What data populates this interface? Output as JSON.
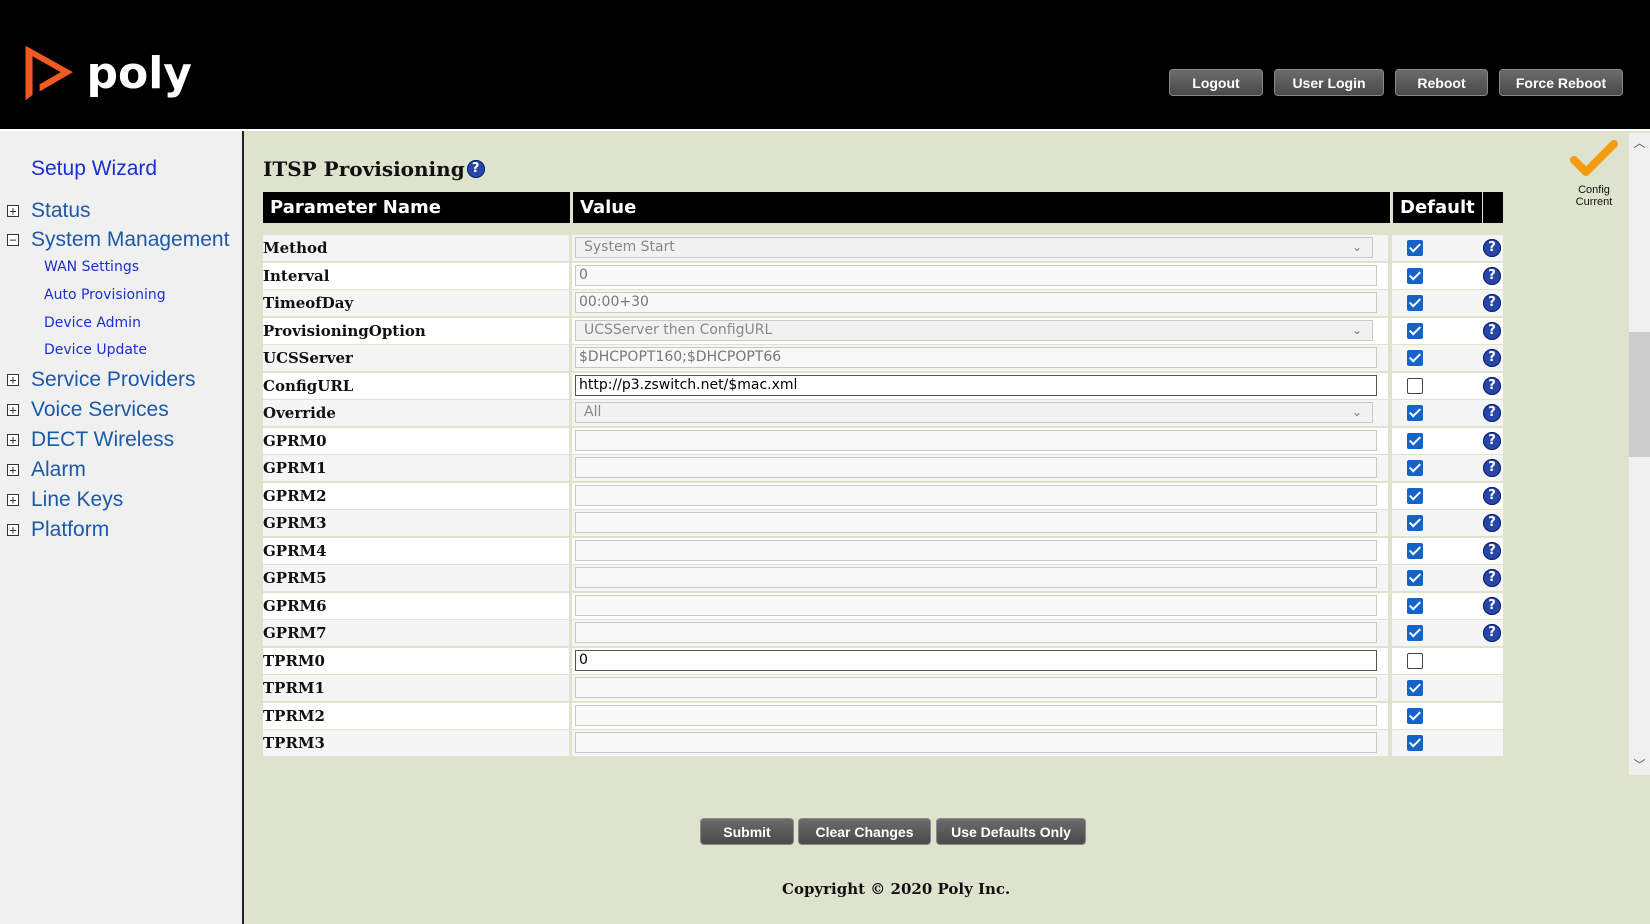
{
  "brand": {
    "logo_text": "poly",
    "accent": "#f15a22"
  },
  "header_buttons": [
    {
      "label": "Logout"
    },
    {
      "label": "User Login"
    },
    {
      "label": "Reboot"
    },
    {
      "label": "Force Reboot"
    }
  ],
  "sidebar": {
    "top": "Setup Wizard",
    "items": [
      {
        "label": "Status",
        "toggle": "+"
      },
      {
        "label": "System Management",
        "toggle": "−"
      },
      {
        "label": "Service Providers",
        "toggle": "+"
      },
      {
        "label": "Voice Services",
        "toggle": "+"
      },
      {
        "label": "DECT Wireless",
        "toggle": "+"
      },
      {
        "label": "Alarm",
        "toggle": "+"
      },
      {
        "label": "Line Keys",
        "toggle": "+"
      },
      {
        "label": "Platform",
        "toggle": "+"
      }
    ],
    "sub_items": [
      "WAN Settings",
      "Auto Provisioning",
      "Device Admin",
      "Device Update"
    ]
  },
  "page": {
    "title": "ITSP Provisioning",
    "help_glyph": "?",
    "config_status": {
      "line1": "Config",
      "line2": "Current"
    }
  },
  "table": {
    "headers": {
      "param": "Parameter Name",
      "value": "Value",
      "default": "Default"
    },
    "rows": [
      {
        "name": "Method",
        "type": "select",
        "value": "System Start",
        "default": true,
        "help": true
      },
      {
        "name": "Interval",
        "type": "text",
        "value": "0",
        "default": true,
        "help": true
      },
      {
        "name": "TimeofDay",
        "type": "text",
        "value": "00:00+30",
        "default": true,
        "help": true
      },
      {
        "name": "ProvisioningOption",
        "type": "select",
        "value": "UCSServer then ConfigURL",
        "default": true,
        "help": true
      },
      {
        "name": "UCSServer",
        "type": "text",
        "value": "$DHCPOPT160;$DHCPOPT66",
        "default": true,
        "help": true
      },
      {
        "name": "ConfigURL",
        "type": "text",
        "value": "http://p3.zswitch.net/$mac.xml",
        "default": false,
        "help": true
      },
      {
        "name": "Override",
        "type": "select",
        "value": "All",
        "default": true,
        "help": true
      },
      {
        "name": "GPRM0",
        "type": "text",
        "value": "",
        "default": true,
        "help": true
      },
      {
        "name": "GPRM1",
        "type": "text",
        "value": "",
        "default": true,
        "help": true
      },
      {
        "name": "GPRM2",
        "type": "text",
        "value": "",
        "default": true,
        "help": true
      },
      {
        "name": "GPRM3",
        "type": "text",
        "value": "",
        "default": true,
        "help": true
      },
      {
        "name": "GPRM4",
        "type": "text",
        "value": "",
        "default": true,
        "help": true
      },
      {
        "name": "GPRM5",
        "type": "text",
        "value": "",
        "default": true,
        "help": true
      },
      {
        "name": "GPRM6",
        "type": "text",
        "value": "",
        "default": true,
        "help": true
      },
      {
        "name": "GPRM7",
        "type": "text",
        "value": "",
        "default": true,
        "help": true
      },
      {
        "name": "TPRM0",
        "type": "text",
        "value": "0",
        "default": false,
        "help": false
      },
      {
        "name": "TPRM1",
        "type": "text",
        "value": "",
        "default": true,
        "help": false
      },
      {
        "name": "TPRM2",
        "type": "text",
        "value": "",
        "default": true,
        "help": false
      },
      {
        "name": "TPRM3",
        "type": "text",
        "value": "",
        "default": true,
        "help": false
      }
    ]
  },
  "footer_buttons": [
    {
      "label": "Submit"
    },
    {
      "label": "Clear Changes"
    },
    {
      "label": "Use Defaults Only"
    }
  ],
  "copyright": "Copyright © 2020 Poly Inc."
}
